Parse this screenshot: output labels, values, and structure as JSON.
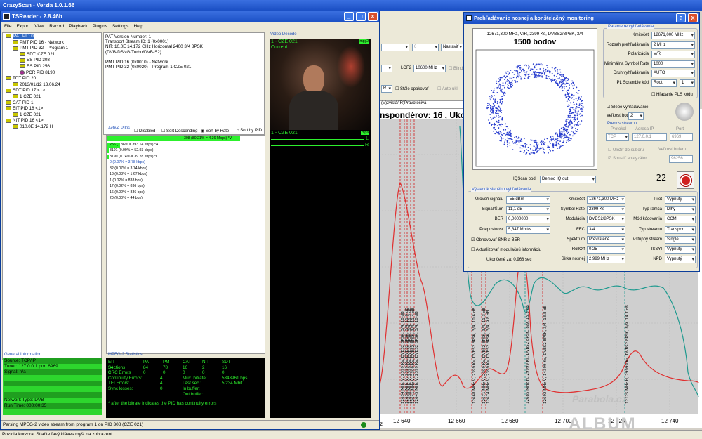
{
  "crazyscan": {
    "title": "CrazyScan - Verzia 1.0.1.66",
    "lof2_label": "LOF2",
    "lof2_value": "10600 MHz",
    "blind_label": "Blind",
    "nastavit_label": "Nastaviť",
    "zero_value": "0",
    "stale_opakovat": "Stále opakovať",
    "auto_label": "Auto-ukl.",
    "r_value": "R",
    "tab_label": "(V)zvislá/(R)Pravotočivá",
    "chart_title": "nspondérov: 16 , Ukončen",
    "x_ticks": [
      "12 640",
      "12 660",
      "12 680",
      "12 700",
      "12 720",
      "12 740"
    ],
    "x_unit": "z",
    "status_bar": "Pozícia kurzora: Stlačte ľavý kláves myši na zobrazení",
    "watermark_top": "Parabola.cz",
    "watermark_bottom": "ALBUM",
    "transponder_labels": [
      "12634 MHz V, 2399 Ks, DVBS2 8PSK, 3/4, 10 dB",
      "12636 MHz V, 2399 Ks, DVBS2 8PSK, 3/4, 11.0 dB",
      "12638 MHz V, 2399 Ks, DVBS2 8PSK, 3/4, 11.3 dB",
      "12641 MHz V, 2399 Ks, DVBS2 8PSK, 3/4, 11.4 dB",
      "12645 MHz V, 2399 Ks, DVBS2 8PSK, 3/4, 10 dB",
      "12668 MHz V, 2399 Ks, DVBS2 8PSK, 3/4, 10.6 dB",
      "12671 MHz V, 2399 Ks, DVBS2 8PSK, 3/4, 11.3 dB",
      "12674 MHz V, 2399 Ks, DVBS2 8PSK, 3/4, 9.8 dB",
      "12685 MHz H, 29999 Ks, DVBS2 8PSK, 8/9, 15.3 dB",
      "12692 MHz V, 14399 Ks, DVBS2 8PSK, 3/4, 13.8 dB",
      "12725 MHz H, 29999 Ks, DVBS2 8PSK, 8/9, 14.7 dB"
    ]
  },
  "tsreader": {
    "title": "TSReader - 2.8.46b",
    "menu": [
      "File",
      "Export",
      "View",
      "Record",
      "Playback",
      "Plugins",
      "Settings",
      "Help"
    ],
    "tree": [
      {
        "d": 0,
        "t": "PAT PID 0",
        "sel": true
      },
      {
        "d": 1,
        "t": "PMT PID 16 - Network"
      },
      {
        "d": 1,
        "t": "PMT PID 32 - Program 1"
      },
      {
        "d": 2,
        "t": "SDT: CZE 021"
      },
      {
        "d": 2,
        "t": "ES PID 308"
      },
      {
        "d": 2,
        "t": "ES PID 256"
      },
      {
        "d": 2,
        "t": "PCR PID 8190",
        "pcr": true
      },
      {
        "d": 0,
        "t": "TDT PID 20"
      },
      {
        "d": 1,
        "t": "2013/01/12 13.06.24"
      },
      {
        "d": 0,
        "t": "SDT PID 17 <1>"
      },
      {
        "d": 1,
        "t": "1 CZE 021"
      },
      {
        "d": 0,
        "t": "CAT PID 1"
      },
      {
        "d": 0,
        "t": "EIT PID 18 <1>"
      },
      {
        "d": 1,
        "t": "1 CZE 021"
      },
      {
        "d": 0,
        "t": "NIT PID 16 <1>"
      },
      {
        "d": 1,
        "t": "010.0E 14.172 H"
      }
    ],
    "info_lines": [
      "PAT Version Number: 1",
      "Transport Stream ID: 1 (0x0001)",
      "NIT: 10.0E 14.172 GHz Horizontal  2400 3/4 8PSK",
      "(DVB-DSNG/Turbo/DVB-S2)",
      "",
      "PMT PID 16 (0x0010) - Network",
      "PMT PID 32 (0x0020) - Program 1 CZE 021"
    ],
    "video_decode": "Video Decode",
    "video_channel": "1 - CZE 021",
    "video_current": "Current",
    "video_badge": "mpg2",
    "audio_channel": "1 - CZE 021",
    "audio_badge": "mpa",
    "audio_l": "L",
    "audio_r": "R",
    "active_pids": "Active PIDs",
    "disabled_label": "Disabled",
    "sort_desc": "Sort Descending",
    "sort_rate": "Sort by Rate",
    "sort_pid": "Sort by PID",
    "pid_lines": [
      "308 (80.21% = 4.36 Mbps) *V",
      "256 (7.36% = 393.14 kbps) *A",
      "8191 (0.99% = 52.93 kbps)",
      "8190 (0.74% = 39.28 kbps) *I",
      "0 (0.07% = 3.78 kbps)",
      "32 (0.07% = 3.74 kbps)",
      "18 (0.03% = 1.67 kbps)",
      "1 (0.02% = 838 bps)",
      "17 (0.02% = 836 bps)",
      "16 (0.02% = 836 bps)",
      "20 (0.00% = 44 bps)"
    ],
    "general_info": "General Information",
    "source": "Source: TCP/IP",
    "tuner": "Tuner: 127.0.0.1 port 6969",
    "signal": "Signal: n/a",
    "network_type": "Network Type: DVB",
    "run_time": "Run Time: 000:00:35",
    "mpeg_stats": "MPEG-2 Statistics",
    "stats_header": [
      "",
      "PAT",
      "PMT",
      "CAT",
      "NIT",
      "SDT",
      "EIT"
    ],
    "stats_rows": [
      [
        "Sections",
        "84",
        "78",
        "16",
        "2",
        "16",
        "34"
      ],
      [
        "CRC Errors",
        "0",
        "0",
        "0",
        "0",
        "0",
        "0"
      ]
    ],
    "stats_extra": [
      [
        "Continuity Errors:",
        "4",
        "Mux. bitrate:",
        "5343961 bps"
      ],
      [
        "TEI Errors:",
        "4",
        "Last sec.:",
        "5.234 Mbit"
      ],
      [
        "Sync losses:",
        "0",
        "In buffer:",
        ""
      ],
      [
        "",
        "",
        "Out buffer:",
        ""
      ]
    ],
    "stats_note": "* after the bitrate indicates the PID has continuity errors",
    "status": "Parsing MPEG-2 video stream from program 1 on PID 308 (CZE 021)"
  },
  "dialog": {
    "title": "Prehľadávanie nosnej a konštelačný monitoring",
    "const_caption": "12671,300 MHz, V/R, 2399 Ks, DVBS2/8PSK, 3/4",
    "const_points": "1500 bodov",
    "iq_label": "IQScan bod",
    "iq_value": "Demod IQ out",
    "counter": "22",
    "params_title": "Parametre vyhľadávania",
    "params": [
      [
        "Kmitočet",
        "12671,000 MHz"
      ],
      [
        "Rozsah prehľadávania",
        "2 MHz"
      ],
      [
        "Polarizácia",
        "V/R"
      ],
      [
        "Minimálna Symbol Rate",
        "1000"
      ],
      [
        "Druh vyhľadávania",
        "AUTO"
      ],
      [
        "PL Scramble kód",
        "Root",
        "1"
      ]
    ],
    "hladanie_pls": "Hľadanie PLS kódu",
    "slepe": "Slepé vyhľadávanie",
    "velkost_bodu_label": "Veľkosť bodu",
    "velkost_bodu": "2",
    "prenos_title": "Prenos streamu",
    "protokol": "Protokol",
    "adresa": "Adresa IP",
    "port": "Port",
    "protokol_v": "TCP",
    "adresa_v": "127.0.0.1",
    "port_v": "6969",
    "ulozit": "Uložiť do súboru",
    "velkost_bufferu": "Veľkosť buferu",
    "spustit": "Spustiť analyzátor",
    "buffer_v": "96256",
    "results_title": "Výsledok slepého vyhľadávania",
    "col1": [
      [
        "Úroveň signálu",
        "-55 dBm"
      ],
      [
        "Signál/Šum",
        "11,1 dB"
      ],
      [
        "BER",
        "0,0000000"
      ],
      [
        "Priepustnosť",
        "5,347 Mbit/s"
      ]
    ],
    "col2": [
      [
        "Kmitočet",
        "12671,300 MHz"
      ],
      [
        "Symbol Rate",
        "2399 Ks"
      ],
      [
        "Modulácia",
        "DVBS2/8PSK"
      ],
      [
        "FEC",
        "3/4"
      ],
      [
        "Spektrum",
        "Prevrátené"
      ],
      [
        "RollOff",
        "0.25"
      ],
      [
        "Šírka nosnej",
        "2,999 MHz"
      ]
    ],
    "col3": [
      [
        "Pilot",
        "Vypnutý"
      ],
      [
        "Typ rámca",
        "Dlhý"
      ],
      [
        "Mód kódovania",
        "CCM"
      ],
      [
        "Typ streamu",
        "Transport"
      ],
      [
        "Vstupný stream",
        "Single"
      ],
      [
        "ISSYI",
        "Vypnutý"
      ],
      [
        "NPD",
        "Vypnutý"
      ]
    ],
    "obnovovat": "Obnovovať SNR a BER",
    "aktualizovat": "Aktualizovať modulačnú informáciu",
    "ukoncene": "Ukončené za: 0.968 sec",
    "help_btn": "?",
    "close_btn": "X"
  }
}
